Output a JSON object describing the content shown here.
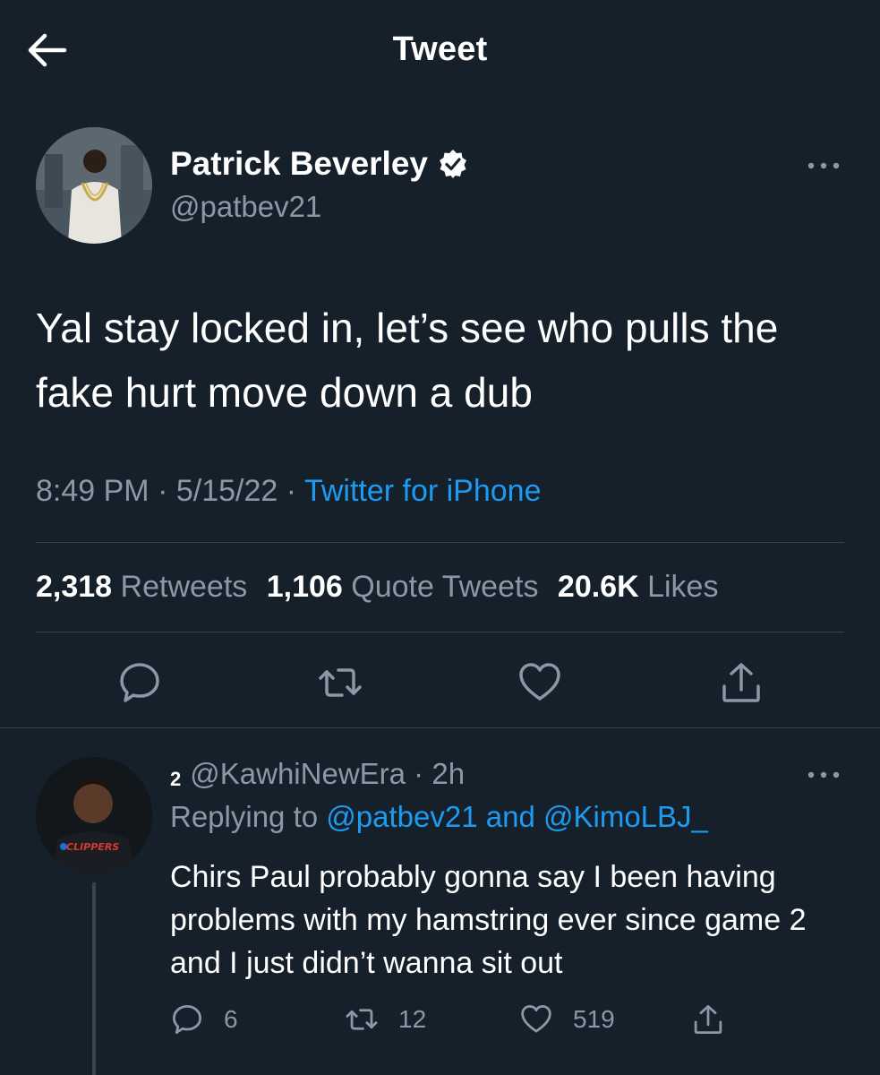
{
  "header": {
    "title": "Tweet"
  },
  "tweet": {
    "author": {
      "name": "Patrick Beverley",
      "handle": "@patbev21"
    },
    "text": "Yal stay locked in, let’s see who pulls the fake hurt move down a dub",
    "time": "8:49 PM",
    "date": "5/15/22",
    "separator": "·",
    "source": "Twitter for iPhone",
    "stats": {
      "retweets": {
        "count": "2,318",
        "label": "Retweets"
      },
      "quotes": {
        "count": "1,106",
        "label": "Quote Tweets"
      },
      "likes": {
        "count": "20.6K",
        "label": "Likes"
      }
    }
  },
  "reply": {
    "badge": "2",
    "handle": "@KawhiNewEra",
    "time": "2h",
    "replying_prefix": "Replying to",
    "mention1": "@patbev21",
    "and": "and",
    "mention2": "@KimoLBJ_",
    "text": "Chirs Paul probably gonna say I been having problems with my hamstring ever since game 2 and I just didn’t wanna sit out",
    "counts": {
      "replies": "6",
      "retweets": "12",
      "likes": "519"
    },
    "avatar_shirt_text": "CLIPPERS"
  },
  "colors": {
    "background": "#15202b",
    "muted": "#8b98a5",
    "accent": "#1d9bf0",
    "divider": "#38444d"
  },
  "icons": {
    "back": "arrow-left-icon",
    "verified": "verified-badge-icon",
    "more": "more-horizontal-icon",
    "reply": "comment-icon",
    "retweet": "retweet-icon",
    "like": "heart-icon",
    "share": "share-icon"
  }
}
